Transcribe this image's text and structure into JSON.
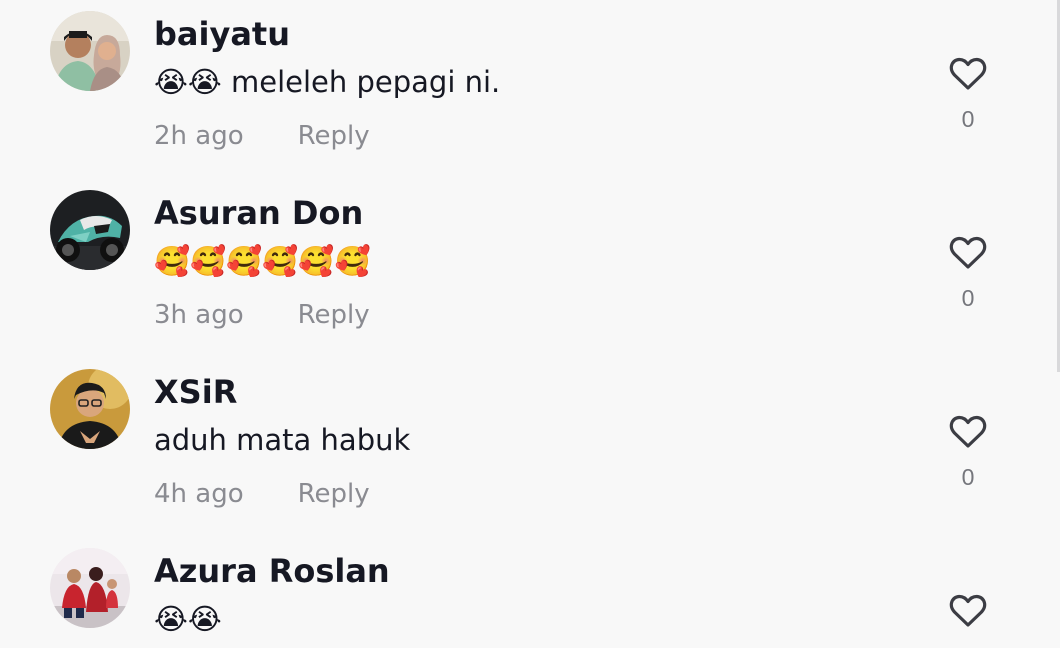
{
  "comments": [
    {
      "username": "baiyatu",
      "text": "😭😭 meleleh pepagi ni.",
      "time": "2h ago",
      "reply_label": "Reply",
      "likes": "0",
      "avatar_icon": "avatar-couple-photo"
    },
    {
      "username": "Asuran Don",
      "text": "🥰🥰🥰🥰🥰🥰",
      "time": "3h ago",
      "reply_label": "Reply",
      "likes": "0",
      "avatar_icon": "avatar-motorcycle-photo"
    },
    {
      "username": "XSiR",
      "text": "aduh mata habuk",
      "time": "4h ago",
      "reply_label": "Reply",
      "likes": "0",
      "avatar_icon": "avatar-man-glasses-photo"
    },
    {
      "username": "Azura Roslan",
      "text": "😭😭",
      "time": "",
      "reply_label": "",
      "likes": "",
      "avatar_icon": "avatar-family-photo"
    }
  ],
  "colors": {
    "background": "#f8f8f8",
    "username": "#161823",
    "meta": "#8a8b91",
    "like_icon": "#3c3d44"
  }
}
